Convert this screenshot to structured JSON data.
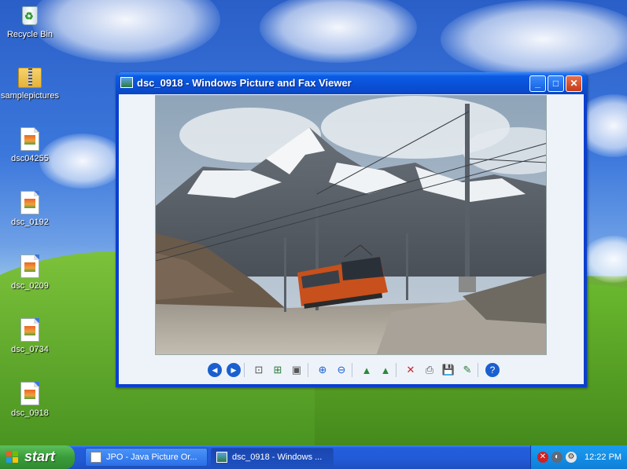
{
  "desktop": {
    "icons": [
      {
        "label": "Recycle Bin",
        "icon": "recycle-bin-icon"
      },
      {
        "label": "samplepictures",
        "icon": "zip-folder-icon"
      },
      {
        "label": "dsc04255",
        "icon": "image-file-icon"
      },
      {
        "label": "dsc_0192",
        "icon": "image-file-icon"
      },
      {
        "label": "dsc_0209",
        "icon": "image-file-icon"
      },
      {
        "label": "dsc_0734",
        "icon": "image-file-icon"
      },
      {
        "label": "dsc_0918",
        "icon": "image-file-icon"
      }
    ]
  },
  "window": {
    "title": "dsc_0918 - Windows Picture and Fax Viewer",
    "controls": {
      "minimize": "_",
      "maximize": "□",
      "close": "✕"
    },
    "photo": {
      "subject": "mountain-railway-photo"
    },
    "toolbar": [
      {
        "name": "previous-image-button",
        "glyph": "◀",
        "color": "#1a5fd0"
      },
      {
        "name": "next-image-button",
        "glyph": "▶",
        "color": "#1a5fd0"
      },
      {
        "name": "best-fit-button",
        "glyph": "⊡",
        "color": "#555555"
      },
      {
        "name": "actual-size-button",
        "glyph": "⊞",
        "color": "#2a7a3a"
      },
      {
        "name": "slideshow-button",
        "glyph": "▣",
        "color": "#555555"
      },
      {
        "name": "zoom-in-button",
        "glyph": "⊕",
        "color": "#1a5fd0"
      },
      {
        "name": "zoom-out-button",
        "glyph": "⊖",
        "color": "#1a5fd0"
      },
      {
        "name": "rotate-clockwise-button",
        "glyph": "▲",
        "color": "#2a8a3a"
      },
      {
        "name": "rotate-counterclockwise-button",
        "glyph": "▲",
        "color": "#2a8a3a"
      },
      {
        "name": "delete-button",
        "glyph": "✕",
        "color": "#d02020"
      },
      {
        "name": "print-button",
        "glyph": "⎙",
        "color": "#555555"
      },
      {
        "name": "save-button",
        "glyph": "💾",
        "color": "#1a4fb0"
      },
      {
        "name": "edit-button",
        "glyph": "✎",
        "color": "#2a7a3a"
      },
      {
        "name": "help-button",
        "glyph": "?",
        "color": "#1a5fd0"
      }
    ]
  },
  "taskbar": {
    "start_label": "start",
    "tasks": [
      {
        "label": "JPO - Java Picture Or...",
        "icon": "java-app-icon",
        "active": false
      },
      {
        "label": "dsc_0918 - Windows ...",
        "icon": "picture-viewer-icon",
        "active": true
      }
    ],
    "tray_icons": [
      "security-alert-icon",
      "volume-icon",
      "network-icon"
    ],
    "clock": "12:22 PM"
  },
  "colors": {
    "titlebar": "#0a50d6",
    "close_button": "#d8481f",
    "taskbar": "#245edb",
    "start_button": "#3a9c3a"
  }
}
